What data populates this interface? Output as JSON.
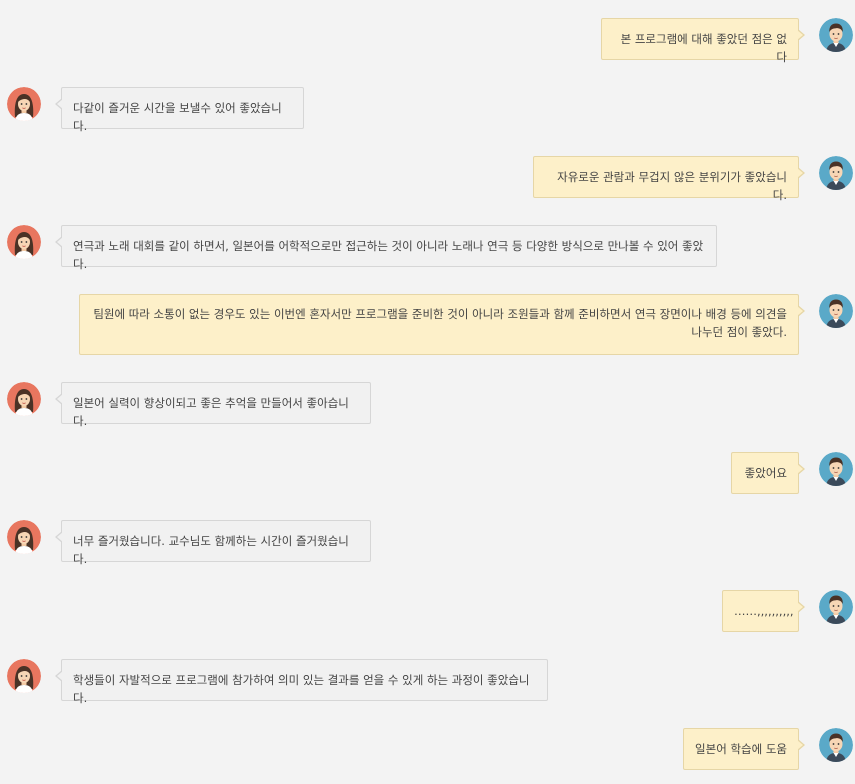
{
  "colors": {
    "background": "#f3f3f3",
    "left_bubble": "#f1f1f1",
    "right_bubble": "#fdf0c9",
    "male_avatar_bg": "#5aa9c8",
    "female_avatar_bg": "#e8765f"
  },
  "avatars": {
    "right": "male-avatar-icon",
    "left": "female-avatar-icon"
  },
  "messages": [
    {
      "side": "right",
      "text": "본 프로그램에 대해 좋았던 점은 없다"
    },
    {
      "side": "left",
      "text": "다같이 즐거운 시간을 보낼수 있어 좋았습니다."
    },
    {
      "side": "right",
      "text": "자유로운 관람과 무겁지 않은 분위기가 좋았습니다."
    },
    {
      "side": "left",
      "text": "연극과 노래 대회를 같이 하면서, 일본어를 어학적으로만 접근하는 것이 아니라 노래나 연극 등 다양한 방식으로 만나볼 수 있어 좋았다."
    },
    {
      "side": "right",
      "text": "팀원에 따라 소통이 없는 경우도 있는 이번엔 혼자서만 프로그램을 준비한 것이 아니라 조원들과 함께 준비하면서 연극 장면이나 배경 등에 의견을 나누던 점이 좋았다."
    },
    {
      "side": "left",
      "text": "일본어 실력이 향상이되고 좋은 추억을 만들어서 좋아습니다."
    },
    {
      "side": "right",
      "text": "좋았어요"
    },
    {
      "side": "left",
      "text": "너무 즐거웠습니다. 교수님도 함께하는 시간이 즐거웠습니다."
    },
    {
      "side": "right",
      "text": "……,,,,,,,,,,"
    },
    {
      "side": "left",
      "text": "학생들이 자발적으로 프로그램에 참가하여 의미 있는 결과를 얻을 수 있게 하는 과정이 좋았습니다."
    },
    {
      "side": "right",
      "text": "일본어 학습에 도움"
    }
  ]
}
